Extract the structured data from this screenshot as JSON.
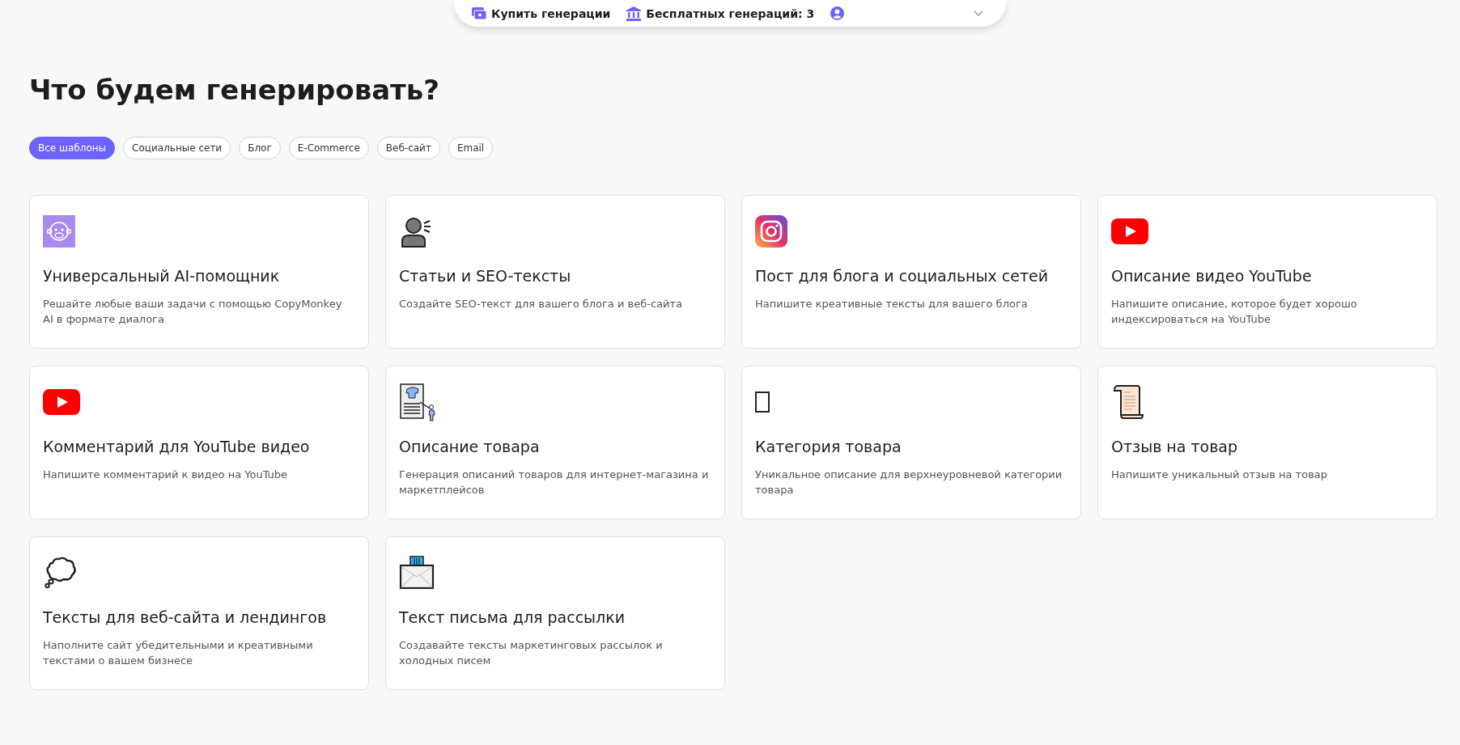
{
  "top_bar": {
    "buy_label": "Купить генерации",
    "free_label": "Бесплатных генераций: 3"
  },
  "heading": "Что будем генерировать?",
  "filters": [
    {
      "label": "Все шаблоны",
      "selected": true
    },
    {
      "label": "Социальные сети",
      "selected": false
    },
    {
      "label": "Блог",
      "selected": false
    },
    {
      "label": "E-Commerce",
      "selected": false
    },
    {
      "label": "Веб-сайт",
      "selected": false
    },
    {
      "label": "Email",
      "selected": false
    }
  ],
  "templates": [
    {
      "kind": "monkey",
      "title": "Универсальный AI-помощник",
      "description": "Решайте любые ваши задачи с помощью CopyMonkey AI в формате диалога"
    },
    {
      "kind": "speaker",
      "title": "Статьи и SEO-тексты",
      "description": "Создайте SEO-текст для вашего блога и веб-сайта"
    },
    {
      "kind": "camera",
      "title": "Пост для блога и социальных сетей",
      "description": "Напишите креативные тексты для вашего блога"
    },
    {
      "kind": "play",
      "title": "Описание видео YouTube",
      "description": "Напишите описание, которое будет хорошо индексироваться на YouTube"
    },
    {
      "kind": "play",
      "title": "Комментарий для YouTube видео",
      "description": "Напишите комментарий к видео на YouTube"
    },
    {
      "kind": "poster",
      "title": "Описание товара",
      "description": "Генерация описаний товаров для интернет-магазина и маркетплейсов"
    },
    {
      "kind": "blank",
      "title": "Категория товара",
      "description": "Уникальное описание для верхнеуровневой категории товара"
    },
    {
      "kind": "scroll",
      "title": "Отзыв на товар",
      "description": "Напишите уникальный отзыв на товар"
    },
    {
      "kind": "thought",
      "title": "Тексты для веб-сайта и лендингов",
      "description": "Наполните сайт убедительными и креативными текстами о вашем бизнесе"
    },
    {
      "kind": "envelope",
      "title": "Текст письма для рассылки",
      "description": "Создавайте тексты маркетинговых рассылок и холодных писем"
    }
  ]
}
